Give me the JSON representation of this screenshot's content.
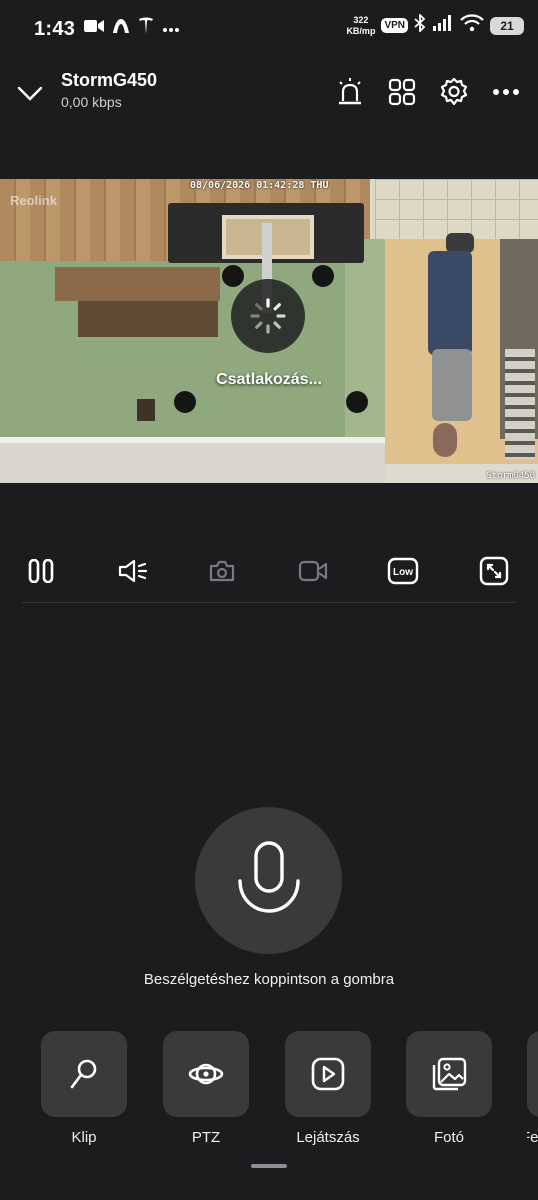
{
  "status_bar": {
    "time": "1:43",
    "left_icons": [
      "video-camera-icon",
      "mountain-app-icon",
      "tesla-icon",
      "more-dots-icon"
    ],
    "speed_value": "322",
    "speed_unit": "KB/mp",
    "vpn_label": "VPN",
    "battery": "21"
  },
  "header": {
    "device_name": "StormG450",
    "bitrate": "0,00 kbps",
    "actions": [
      "siren-icon",
      "multi-view-icon",
      "settings-gear-icon",
      "more-options-icon"
    ]
  },
  "video": {
    "watermark": "Reolink",
    "timestamp": "08/06/2026 01:42:28 THU",
    "camera_name": "StormG450",
    "status_text": "Csatlakozás..."
  },
  "controls": {
    "buttons": [
      "pause-icon",
      "speaker-icon",
      "snapshot-icon",
      "record-icon",
      "quality-icon",
      "fullscreen-icon"
    ],
    "quality_label": "Low",
    "disabled": [
      "snapshot-icon",
      "record-icon"
    ]
  },
  "talk": {
    "hint": "Beszélgetéshez koppintson a gombra"
  },
  "shortcuts": [
    {
      "label": "Klip",
      "icon": "clip-icon"
    },
    {
      "label": "PTZ",
      "icon": "ptz-icon"
    },
    {
      "label": "Lejátszás",
      "icon": "playback-icon"
    },
    {
      "label": "Fotó",
      "icon": "photo-icon"
    },
    {
      "label": "Fe",
      "icon": "partial-icon"
    }
  ],
  "colors": {
    "background": "#1c1c1e",
    "tile": "#3a3a3c",
    "text": "#ffffff",
    "muted_icon": "#7a7a7e"
  }
}
